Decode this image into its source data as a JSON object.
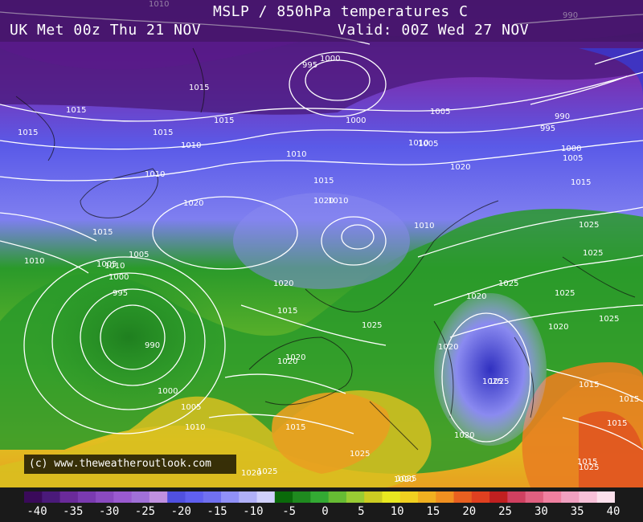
{
  "header": {
    "title": "MSLP / 850hPa temperatures C",
    "run": "UK Met 00z Thu 21 NOV",
    "valid": "Valid: 00Z Wed 27 NOV"
  },
  "copyright": "(c) www.theweatheroutlook.com",
  "colorbar": {
    "ticks": [
      "-40",
      "-35",
      "-30",
      "-25",
      "-20",
      "-15",
      "-10",
      "-5",
      "0",
      "5",
      "10",
      "15",
      "20",
      "25",
      "30",
      "35",
      "40"
    ],
    "colors": {
      "deep_purple": "#4a1a7a",
      "purple": "#7a2fb0",
      "violet": "#9b59d0",
      "blue": "#4a4ae0",
      "light_blue": "#8a8af0",
      "pale_blue": "#b8b8f8",
      "green_dark": "#1f8a1f",
      "green": "#33aa33",
      "yellow_green": "#a8c83a",
      "yellow": "#e8e820",
      "orange": "#f0a020",
      "red": "#e04020",
      "pink": "#f080a0"
    }
  },
  "isobar_labels": [
    "1010",
    "990",
    "1000",
    "995",
    "1000",
    "1005",
    "990",
    "995",
    "1000",
    "1005",
    "1015",
    "1015",
    "1015",
    "1015",
    "1015",
    "1010",
    "1010",
    "1010",
    "1010",
    "1015",
    "1020",
    "1015",
    "1010",
    "1005",
    "1010",
    "1020",
    "1015",
    "1020",
    "1005",
    "1025",
    "1010",
    "1005",
    "1000",
    "995",
    "990",
    "1000",
    "1005",
    "1010",
    "1010",
    "1020",
    "1025",
    "1025",
    "1020",
    "1015",
    "1020",
    "1025",
    "1020",
    "1020",
    "1025",
    "1015",
    "1015",
    "1025",
    "1025",
    "1015",
    "1020",
    "1020",
    "1015",
    "1015",
    "1025",
    "1025",
    "1020",
    "1025",
    "1020",
    "1025",
    "1025"
  ]
}
